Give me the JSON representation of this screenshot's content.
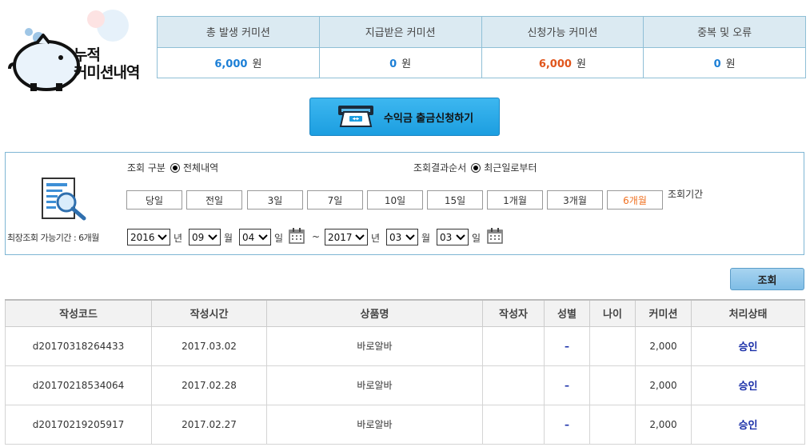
{
  "logo": {
    "line1": "누적",
    "line2": "커미션내역"
  },
  "summary": {
    "headers": [
      "총 발생 커미션",
      "지급받은 커미션",
      "신청가능 커미션",
      "중복 및 오류"
    ],
    "values": [
      {
        "amount": "6,000",
        "unit": "원",
        "color": "#1c7fd6"
      },
      {
        "amount": "0",
        "unit": "원",
        "color": "#1c7fd6"
      },
      {
        "amount": "6,000",
        "unit": "원",
        "color": "#e0551c"
      },
      {
        "amount": "0",
        "unit": "원",
        "color": "#1c7fd6"
      }
    ]
  },
  "withdraw_button": {
    "label": "수익금 출금신청하기"
  },
  "search": {
    "type_label": "조회 구분",
    "type_option": "전체내역",
    "order_label": "조회결과순서",
    "order_option": "최근일로부터",
    "periods": [
      "당일",
      "전일",
      "3일",
      "7일",
      "10일",
      "15일",
      "1개월",
      "3개월",
      "6개월"
    ],
    "active_period": "6개월",
    "period_label": "조회기간",
    "max_note": "최장조회 가능기간 : 6개월",
    "from": {
      "year": "2016",
      "month": "09",
      "day": "04"
    },
    "to": {
      "year": "2017",
      "month": "03",
      "day": "03"
    },
    "units": {
      "year": "년",
      "month": "월",
      "day": "일",
      "tilde": "~"
    },
    "button": "조회"
  },
  "results": {
    "columns": [
      "작성코드",
      "작성시간",
      "상품명",
      "작성자",
      "성별",
      "나이",
      "커미션",
      "처리상태"
    ],
    "rows": [
      {
        "code": "d20170318264433",
        "time": "2017.03.02",
        "product": "바로알바",
        "writer": "",
        "gender": "–",
        "age": "",
        "commission": "2,000",
        "status": "승인"
      },
      {
        "code": "d20170218534064",
        "time": "2017.02.28",
        "product": "바로알바",
        "writer": "",
        "gender": "–",
        "age": "",
        "commission": "2,000",
        "status": "승인"
      },
      {
        "code": "d20170219205917",
        "time": "2017.02.27",
        "product": "바로알바",
        "writer": "",
        "gender": "–",
        "age": "",
        "commission": "2,000",
        "status": "승인"
      }
    ]
  }
}
